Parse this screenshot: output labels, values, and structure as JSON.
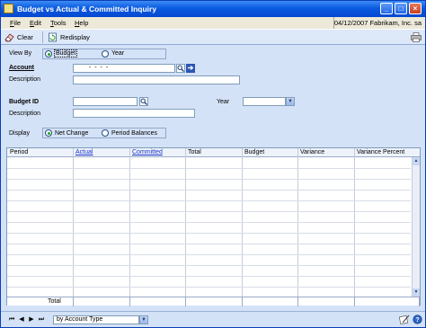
{
  "window": {
    "title": "Budget vs Actual & Committed Inquiry",
    "controls": {
      "minimize": "_",
      "maximize": "□",
      "close": "×"
    }
  },
  "menu": {
    "items": [
      "File",
      "Edit",
      "Tools",
      "Help"
    ],
    "status": "04/12/2007  Fabrikam, Inc.  sa"
  },
  "toolbar": {
    "clear_label": "Clear",
    "redisplay_label": "Redisplay"
  },
  "form": {
    "view_by_label": "View By",
    "view_by_options": [
      "Budget",
      "Year"
    ],
    "view_by_selected": "Budget",
    "account_label": "Account",
    "account_mask": "-    -    -    -",
    "description_label": "Description",
    "budget_id_label": "Budget ID",
    "year_label": "Year",
    "budget_description_label": "Description",
    "display_label": "Display",
    "display_options": [
      "Net Change",
      "Period Balances"
    ],
    "display_selected": "Net Change"
  },
  "grid": {
    "columns": [
      {
        "label": "Period",
        "link": false
      },
      {
        "label": "Actual",
        "link": true
      },
      {
        "label": "Committed",
        "link": true
      },
      {
        "label": "Total",
        "link": false
      },
      {
        "label": "Budget",
        "link": false
      },
      {
        "label": "Variance",
        "link": false
      },
      {
        "label": "Variance Percent",
        "link": false
      }
    ],
    "total_label": "Total"
  },
  "bottom": {
    "sort_value": "by Account Type"
  },
  "icons": {
    "app": "ledger-icon",
    "clear": "eraser-icon",
    "redisplay": "redisplay-icon",
    "print": "printer-icon",
    "lookup": "magnifier-icon",
    "expand": "arrow-right-icon",
    "note": "note-icon",
    "help": "help-icon"
  },
  "colors": {
    "title_bar": "#0a5ae0",
    "window_bg": "#d4e2f7",
    "link": "#1a34c8",
    "radio_selected": "#21a121"
  }
}
